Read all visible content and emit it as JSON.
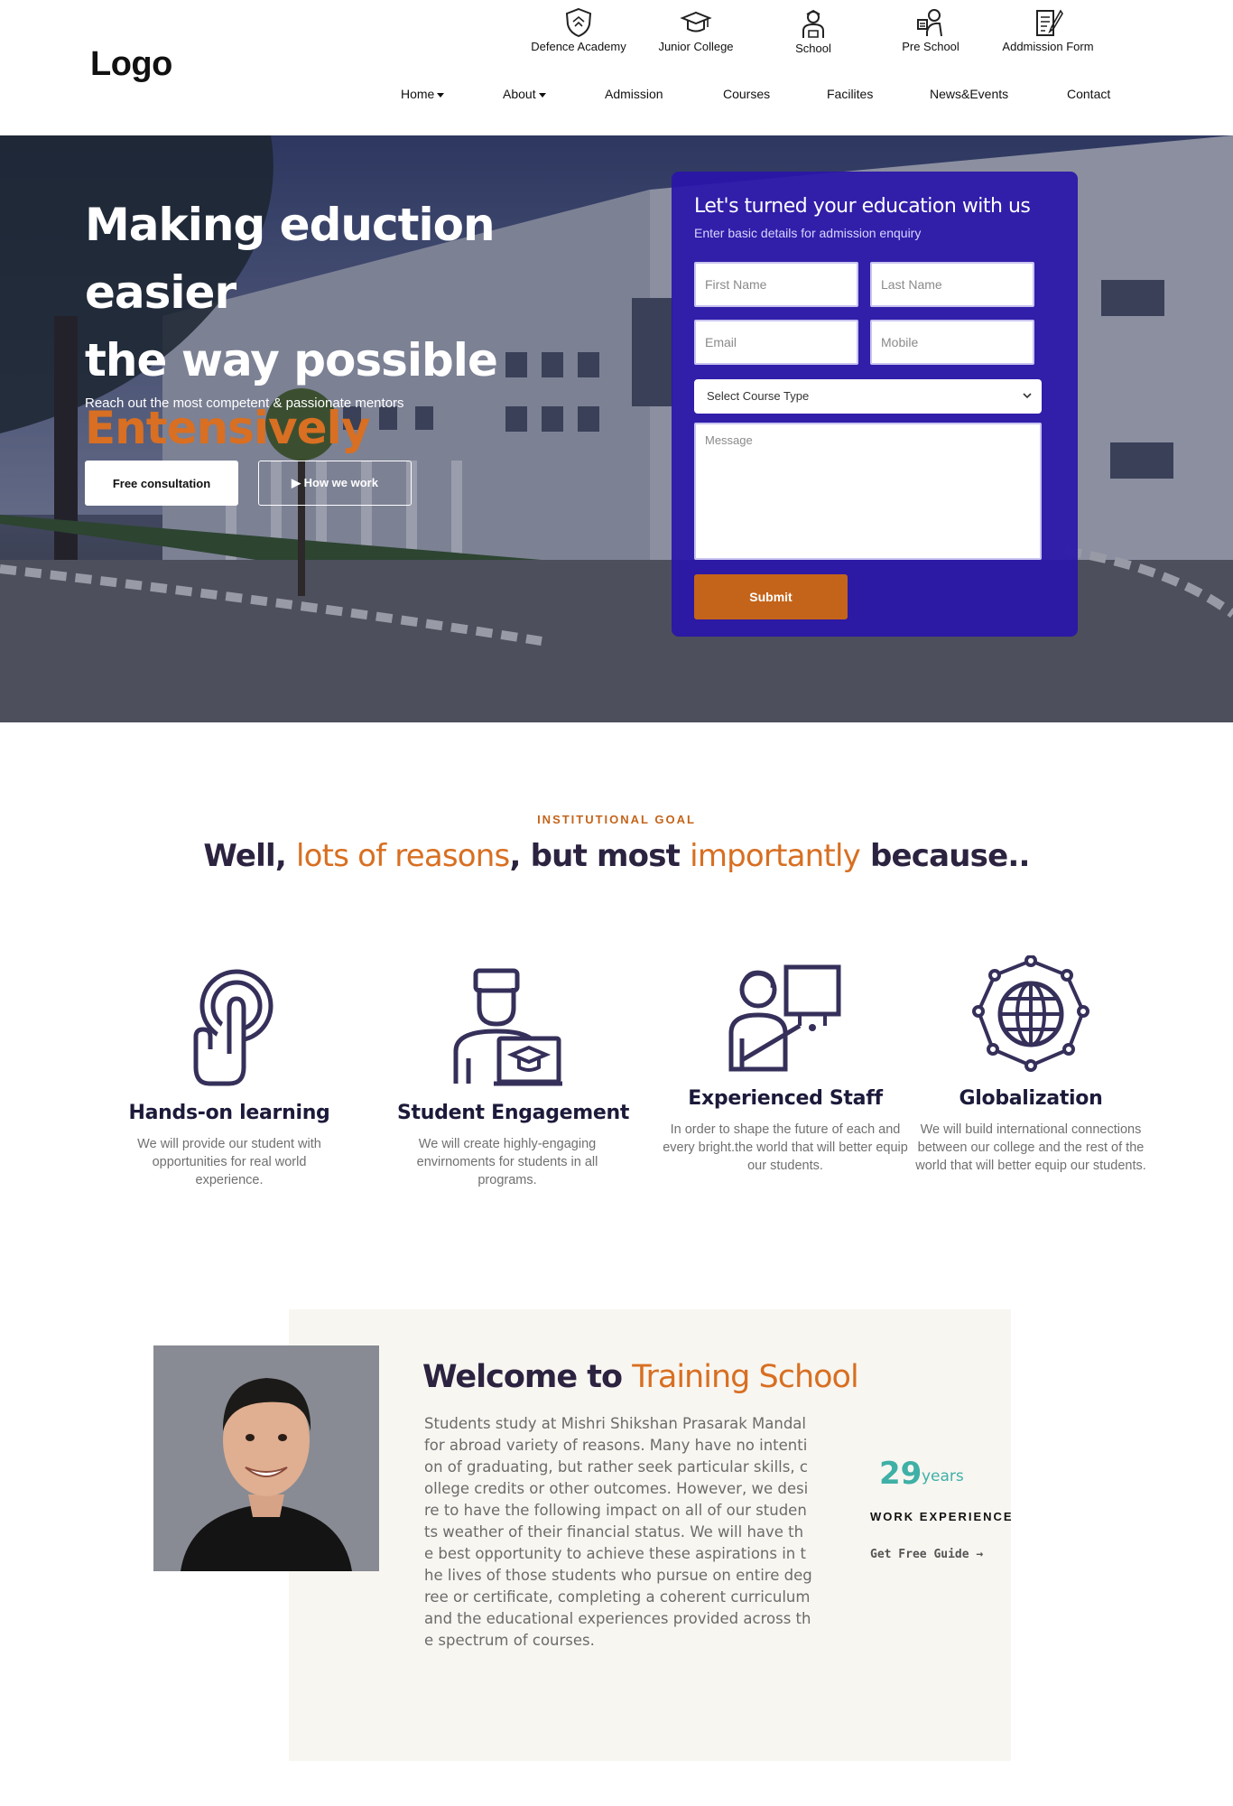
{
  "header": {
    "logo": "Logo",
    "quick_links": [
      {
        "label": "Defence Academy",
        "icon": "shield-icon"
      },
      {
        "label": "Junior College",
        "icon": "graduation-cap-icon"
      },
      {
        "label": "School",
        "icon": "student-icon"
      },
      {
        "label": "Pre School",
        "icon": "pre-school-icon"
      },
      {
        "label": "Addmission Form",
        "icon": "form-icon"
      }
    ],
    "nav": [
      {
        "label": "Home",
        "dropdown": true
      },
      {
        "label": "About",
        "dropdown": true
      },
      {
        "label": "Admission",
        "dropdown": false
      },
      {
        "label": "Courses",
        "dropdown": false
      },
      {
        "label": "Facilites",
        "dropdown": false
      },
      {
        "label": "News&Events",
        "dropdown": false
      },
      {
        "label": "Contact",
        "dropdown": false
      }
    ]
  },
  "hero": {
    "title_line1": "Making eduction easier",
    "title_line2": "the way possible",
    "title_accent": "Entensively",
    "subtitle": "Reach out the most competent & passionate mentors",
    "consult_label": "Free consultation",
    "how_label": "▶ How we work",
    "accent_color": "#d86f22"
  },
  "enquiry": {
    "title": "Let's turned your education with us",
    "subtitle": "Enter basic details for admission enquiry",
    "first_name_placeholder": "First Name",
    "last_name_placeholder": "Last Name",
    "email_placeholder": "Email",
    "mobile_placeholder": "Mobile",
    "course_select": "Select Course Type",
    "message_placeholder": "Message",
    "submit_label": "Submit",
    "panel_color": "#2a16aa",
    "submit_color": "#c4641a"
  },
  "goals": {
    "eyebrow": "INSTITUTIONAL GOAL",
    "heading_part1": "Well, ",
    "heading_part2": "lots of reasons",
    "heading_part3": ", but most ",
    "heading_part4": "importantly",
    "heading_part5": " because..",
    "features": [
      {
        "title": "Hands-on learning",
        "icon": "pointing-hand-icon",
        "desc": "We will provide our student with opportunities for real world experience."
      },
      {
        "title": "Student Engagement",
        "icon": "student-laptop-icon",
        "desc": "We will create highly-engaging envirnoments for students in all programs."
      },
      {
        "title": "Experienced Staff",
        "icon": "teacher-board-icon",
        "desc": "In order to shape the future of each and every bright.the world that will better equip our students."
      },
      {
        "title": "Globalization",
        "icon": "globe-network-icon",
        "desc": "We will build international connections between our college and the rest of the world that will better equip our students."
      }
    ]
  },
  "welcome": {
    "title_part1": "Welcome to ",
    "title_part2": "Training School",
    "body": "Students study at Mishri Shikshan Prasarak Mandal for abroad variety of reasons. Many have no intention of graduating, but rather seek particular skills, college credits or other outcomes. However, we desire to have the following impact on all of our students weather of their financial status. We will have the best opportunity to achieve these aspirations in the lives of those students who pursue on entire degree or certificate, completing a coherent curriculum and the educational experiences provided across the spectrum of courses.",
    "experience_years": "29",
    "experience_unit": "years",
    "experience_label": "WORK EXPERIENCE",
    "guide_label": "Get Free Guide →",
    "teal_color": "#3fb0a6"
  }
}
